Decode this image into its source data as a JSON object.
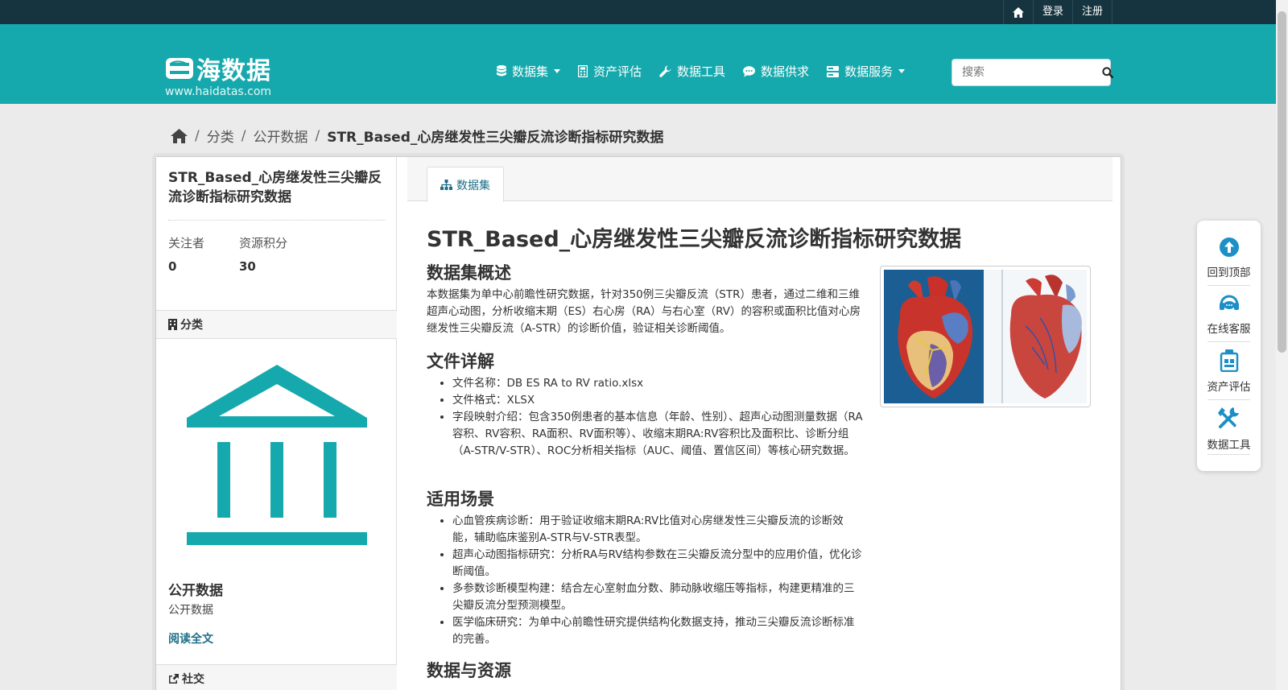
{
  "topbar": {
    "login": "登录",
    "register": "注册"
  },
  "header": {
    "logo_text": "海数据",
    "logo_url": "www.haidatas.com",
    "nav": [
      {
        "label": "数据集",
        "icon": "database-icon",
        "dropdown": true
      },
      {
        "label": "资产评估",
        "icon": "calculator-icon",
        "dropdown": false
      },
      {
        "label": "数据工具",
        "icon": "wrench-icon",
        "dropdown": false
      },
      {
        "label": "数据供求",
        "icon": "comment-icon",
        "dropdown": false
      },
      {
        "label": "数据服务",
        "icon": "server-icon",
        "dropdown": true
      }
    ],
    "search_placeholder": "搜索"
  },
  "breadcrumb": {
    "items": [
      "分类",
      "公开数据"
    ],
    "current": "STR_Based_心房继发性三尖瓣反流诊断指标研究数据"
  },
  "sidebar": {
    "title": "STR_Based_心房继发性三尖瓣反流诊断指标研究数据",
    "stats": [
      {
        "label": "关注者",
        "value": "0"
      },
      {
        "label": "资源积分",
        "value": "30"
      }
    ],
    "category_heading": "分类",
    "org_name": "公开数据",
    "org_desc": "公开数据",
    "read_more": "阅读全文",
    "social_heading": "社交"
  },
  "content": {
    "tab_label": "数据集",
    "title": "STR_Based_心房继发性三尖瓣反流诊断指标研究数据",
    "overview_heading": "数据集概述",
    "overview_text": "本数据集为单中心前瞻性研究数据，针对350例三尖瓣反流（STR）患者，通过二维和三维超声心动图，分析收缩末期（ES）右心房（RA）与右心室（RV）的容积或面积比值对心房继发性三尖瓣反流（A-STR）的诊断价值，验证相关诊断阈值。",
    "file_heading": "文件详解",
    "file_items": [
      "文件名称：DB ES RA to RV ratio.xlsx",
      "文件格式：XLSX",
      "字段映射介绍：包含350例患者的基本信息（年龄、性别）、超声心动图测量数据（RA容积、RV容积、RA面积、RV面积等）、收缩末期RA:RV容积比及面积比、诊断分组（A-STR/V-STR）、ROC分析相关指标（AUC、阈值、置信区间）等核心研究数据。"
    ],
    "scenario_heading": "适用场景",
    "scenario_items": [
      "心血管疾病诊断：用于验证收缩末期RA:RV比值对心房继发性三尖瓣反流的诊断效能，辅助临床鉴别A-STR与V-STR表型。",
      "超声心动图指标研究：分析RA与RV结构参数在三尖瓣反流分型中的应用价值，优化诊断阈值。",
      "多参数诊断模型构建：结合左心室射血分数、肺动脉收缩压等指标，构建更精准的三尖瓣反流分型预测模型。",
      "医学临床研究：为单中心前瞻性研究提供结构化数据支持，推动三尖瓣反流诊断标准的完善。"
    ],
    "resources_heading": "数据与资源"
  },
  "float_panel": [
    {
      "label": "回到顶部",
      "icon": "arrow-up-circle-icon"
    },
    {
      "label": "在线客服",
      "icon": "headset-icon"
    },
    {
      "label": "资产评估",
      "icon": "clipboard-icon"
    },
    {
      "label": "数据工具",
      "icon": "tools-icon"
    }
  ],
  "colors": {
    "brand": "#15a9ad",
    "topbar": "#15343f",
    "link": "#1d6e88"
  }
}
